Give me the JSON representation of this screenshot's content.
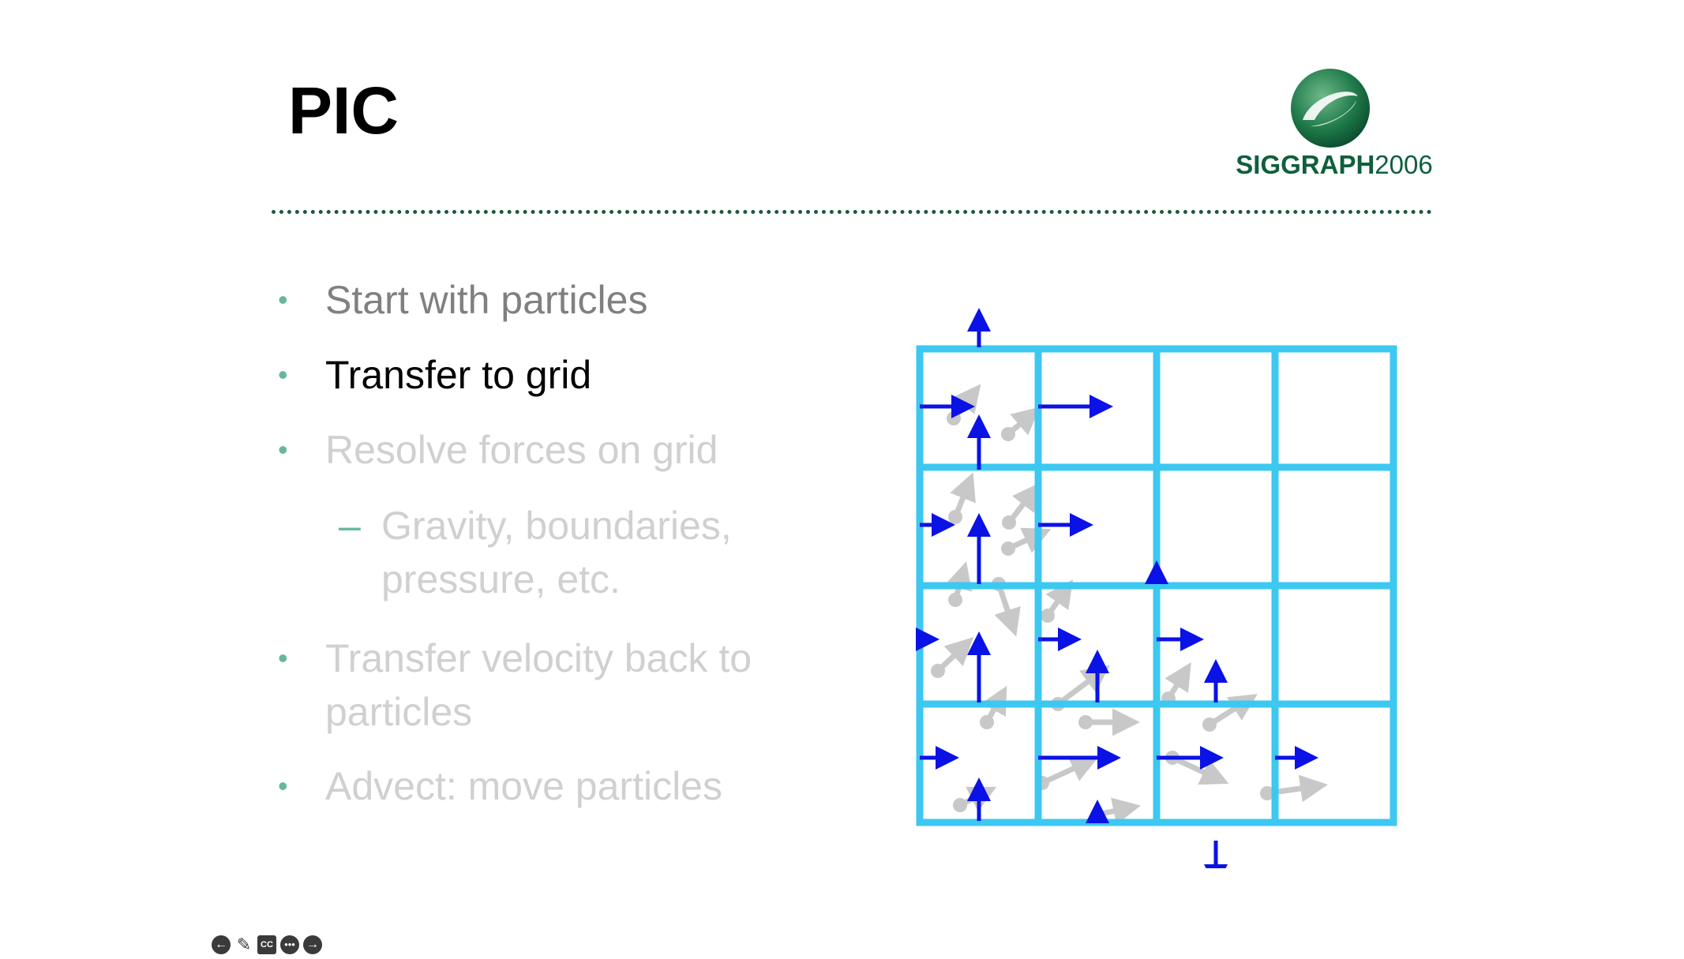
{
  "slide": {
    "title": "PIC",
    "logo": {
      "brand": "SIGGRAPH",
      "year": "2006",
      "color": "#0f5f3c"
    },
    "bullets": [
      {
        "text": "Start with particles",
        "state": "previous"
      },
      {
        "text": "Transfer to grid",
        "state": "current"
      },
      {
        "text": "Resolve forces on grid",
        "state": "upcoming"
      },
      {
        "text": "Gravity, boundaries, pressure, etc.",
        "state": "upcoming",
        "sub": true,
        "marker": "–"
      },
      {
        "text": "Transfer velocity back to particles",
        "state": "upcoming"
      },
      {
        "text": "Advect: move particles",
        "state": "upcoming"
      }
    ],
    "bullet_marker": "•"
  },
  "diagram": {
    "grid_color": "#3cc8f0",
    "grid_velocity_color": "#0a12e6",
    "particle_color": "#c8c8c8",
    "rows": 4,
    "cols": 4
  },
  "nav": {
    "icons": [
      "back-icon",
      "pen-icon",
      "captions-icon",
      "more-icon",
      "forward-icon"
    ]
  }
}
